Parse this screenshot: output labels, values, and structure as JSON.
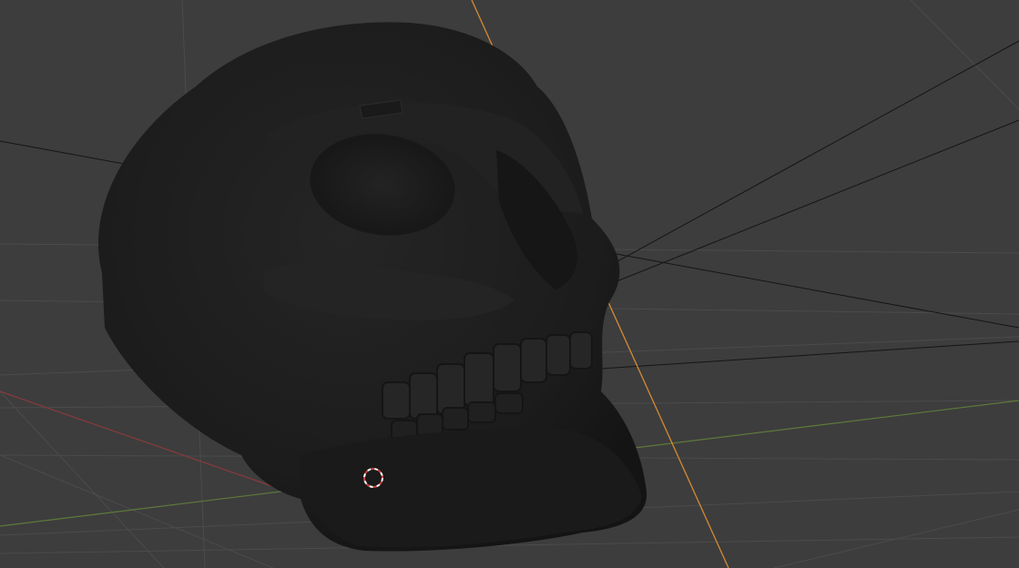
{
  "viewport": {
    "background_color": "#3d3d3d",
    "grid_line_color": "#4a4a4a",
    "x_axis_color": "#8a3a3a",
    "y_axis_color": "#5e7a3a",
    "z_axis_color": "#d58a32",
    "lamp_line_color": "#111111",
    "object_color": "#1d1d1d",
    "object_name": "skull",
    "cursor_icon": "3d-cursor-icon"
  }
}
